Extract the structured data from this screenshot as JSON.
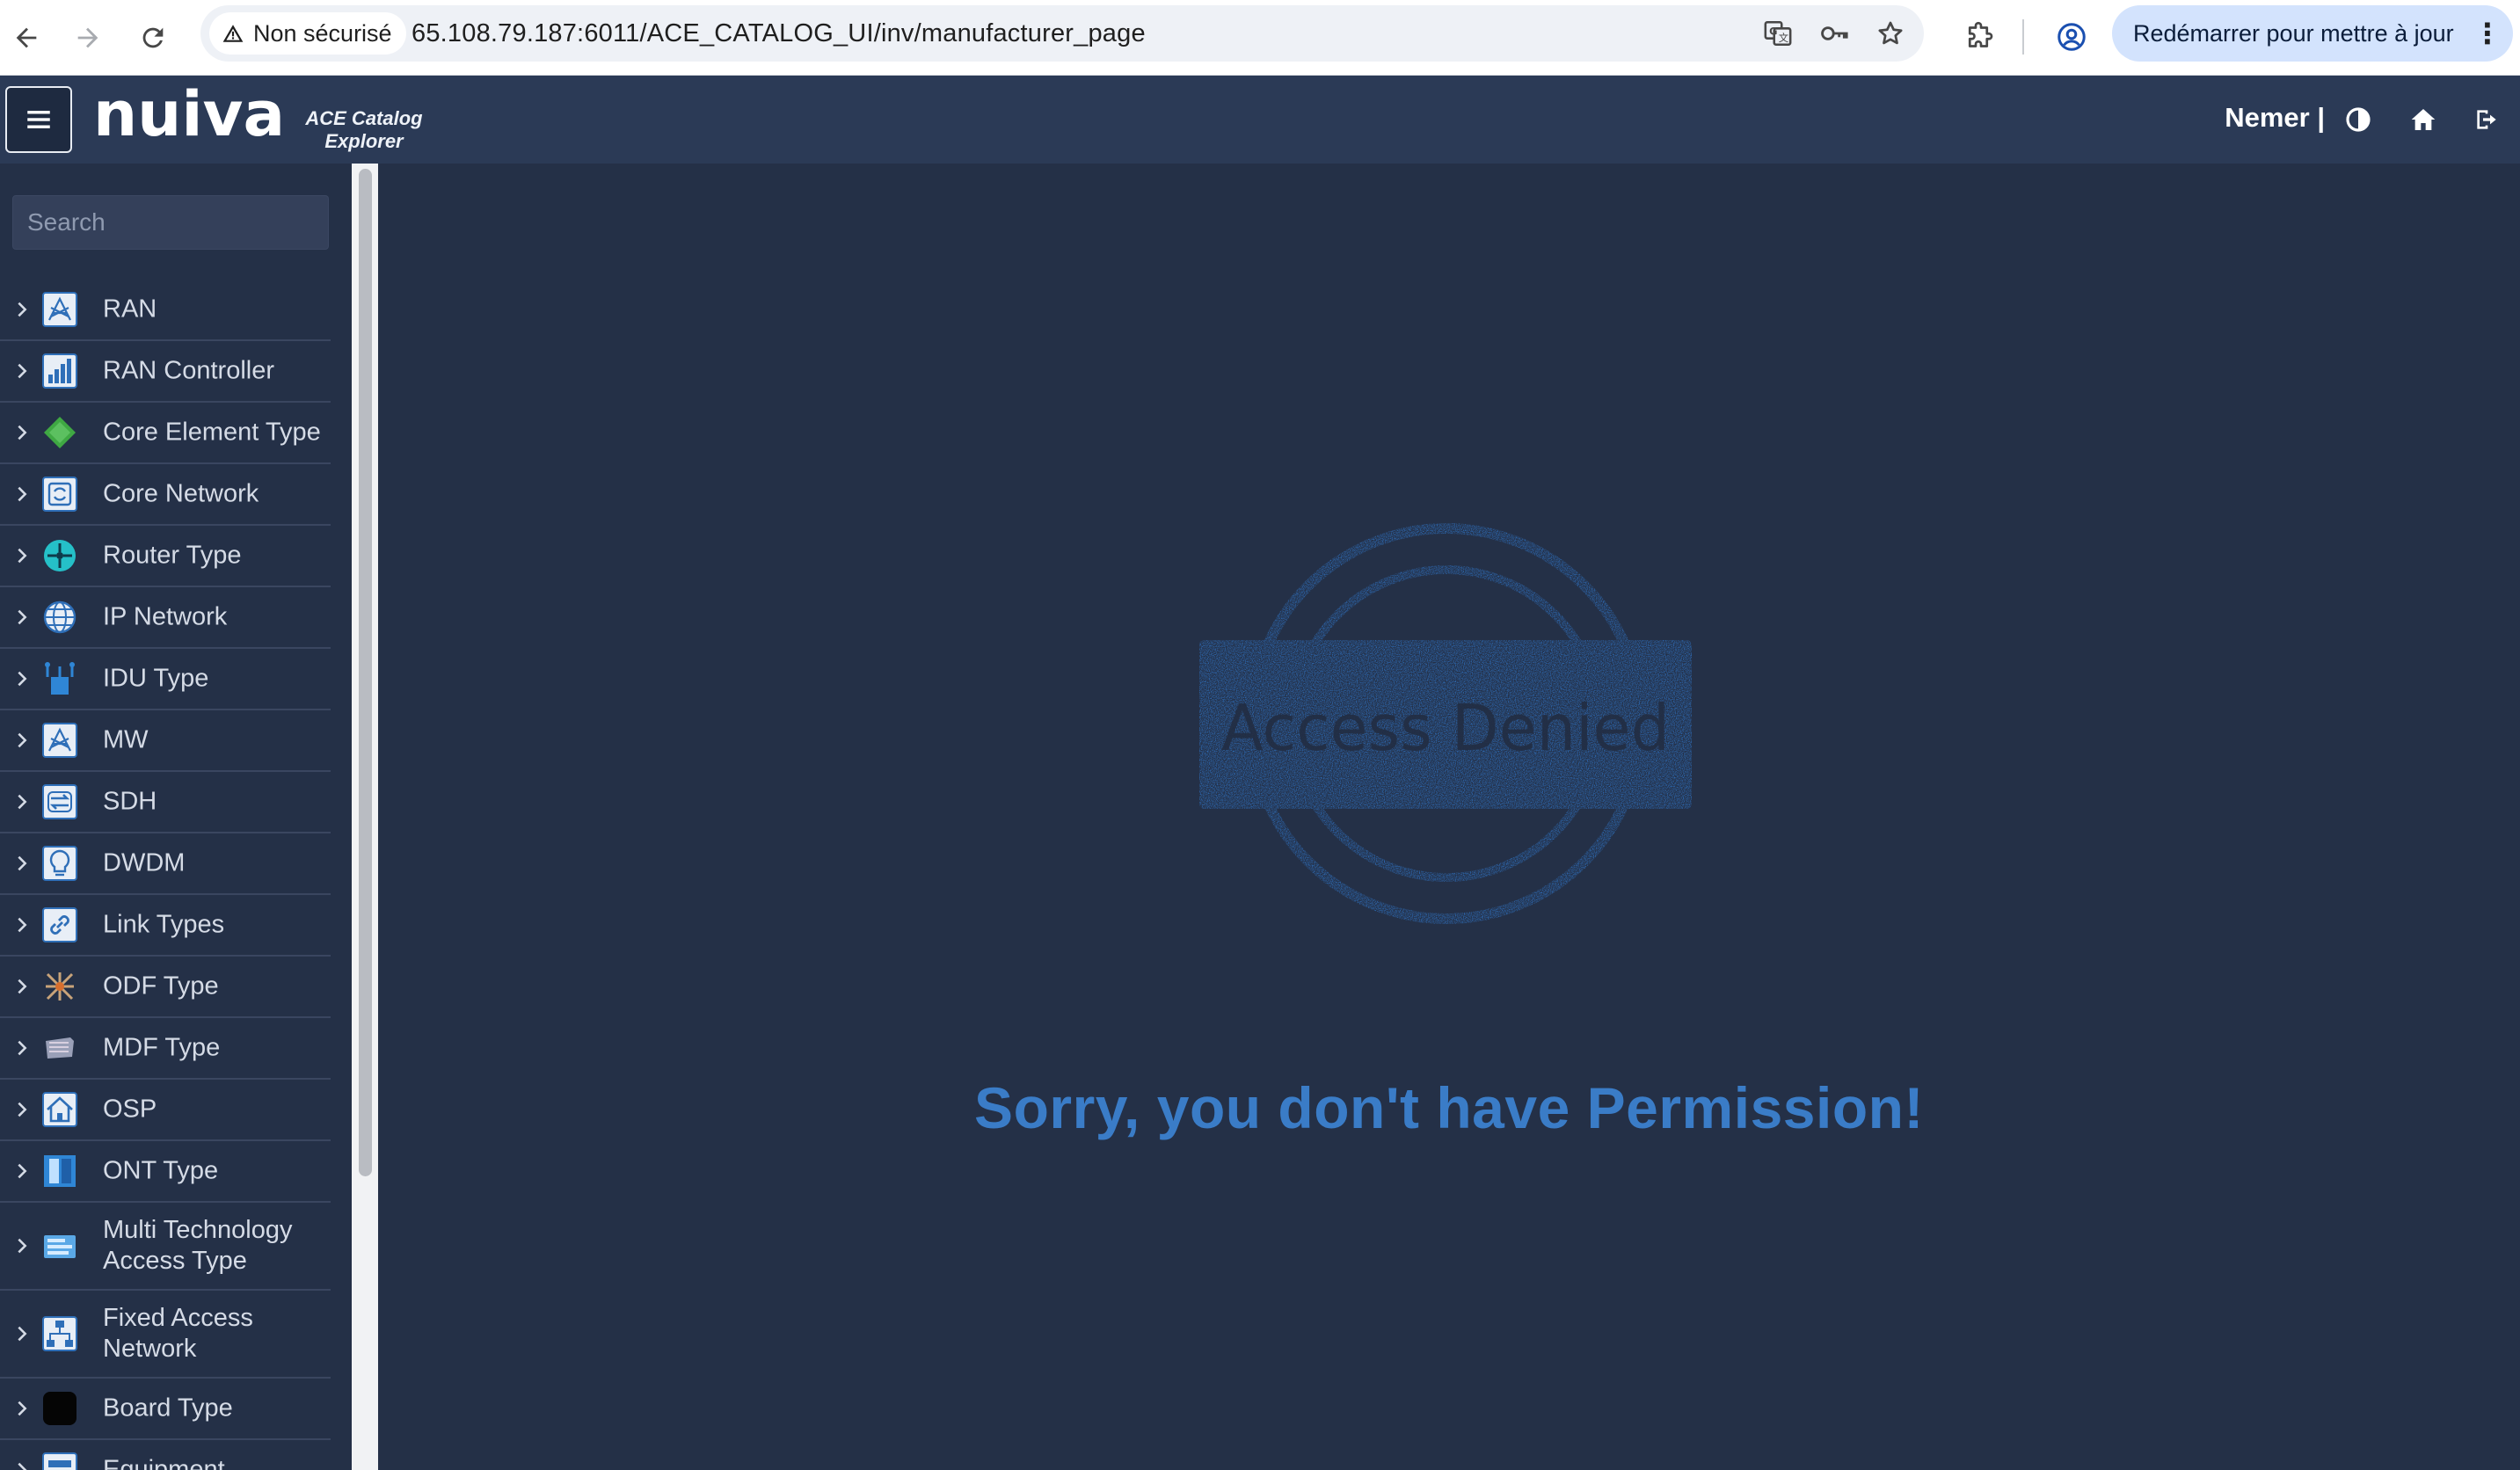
{
  "browser": {
    "security_label": "Non sécurisé",
    "url": "65.108.79.187:6011/ACE_CATALOG_UI/inv/manufacturer_page",
    "update_button_label": "Redémarrer pour mettre à jour",
    "menu_glyph": "⋮"
  },
  "header": {
    "logo_text": "nuiva",
    "subtitle_line1": "ACE Catalog",
    "subtitle_line2": "Explorer",
    "user_label": "Nemer |"
  },
  "sidebar": {
    "search_placeholder": "Search",
    "items": [
      {
        "label": "RAN",
        "icon": "ran-icon"
      },
      {
        "label": "RAN Controller",
        "icon": "ran-controller-icon"
      },
      {
        "label": "Core Element Type",
        "icon": "core-element-type-icon"
      },
      {
        "label": "Core Network",
        "icon": "core-network-icon"
      },
      {
        "label": "Router Type",
        "icon": "router-type-icon"
      },
      {
        "label": "IP Network",
        "icon": "ip-network-icon"
      },
      {
        "label": "IDU Type",
        "icon": "idu-type-icon"
      },
      {
        "label": "MW",
        "icon": "mw-icon"
      },
      {
        "label": "SDH",
        "icon": "sdh-icon"
      },
      {
        "label": "DWDM",
        "icon": "dwdm-icon"
      },
      {
        "label": "Link Types",
        "icon": "link-types-icon"
      },
      {
        "label": "ODF Type",
        "icon": "odf-type-icon"
      },
      {
        "label": "MDF Type",
        "icon": "mdf-type-icon"
      },
      {
        "label": "OSP",
        "icon": "osp-icon"
      },
      {
        "label": "ONT Type",
        "icon": "ont-type-icon"
      },
      {
        "label": "Multi Technology Access Type",
        "icon": "multi-technology-access-type-icon"
      },
      {
        "label": "Fixed Access Network",
        "icon": "fixed-access-network-icon"
      },
      {
        "label": "Board Type",
        "icon": "board-type-icon"
      },
      {
        "label": "Equipment",
        "icon": "equipment-icon"
      }
    ]
  },
  "main": {
    "stamp_text": "Access Denied",
    "message": "Sorry, you don't have Permission!"
  },
  "colors": {
    "page_background": "#243047",
    "header_background": "#2b3a56",
    "accent_blue": "#3a7cc7",
    "stamp_blue": "#2f73c4"
  }
}
